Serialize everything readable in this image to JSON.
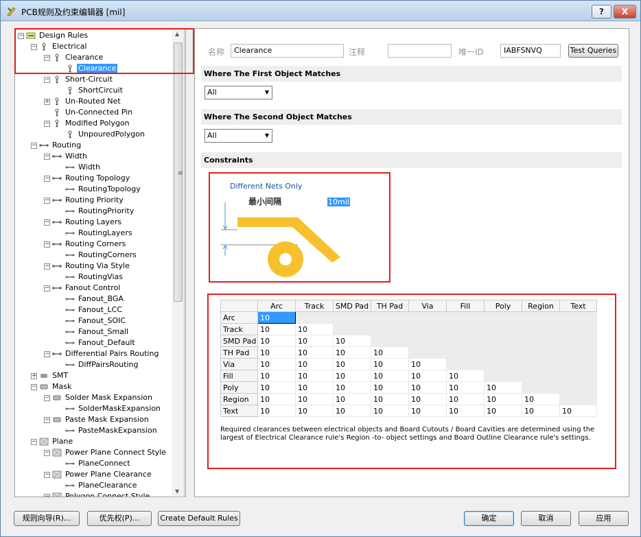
{
  "window": {
    "title": "PCB规则及约束编辑器 [mil]",
    "help_label": "?",
    "close_label": "X"
  },
  "tree": {
    "rows": [
      {
        "label": "Design Rules",
        "exp": "−"
      },
      {
        "label": "Electrical",
        "exp": "−"
      },
      {
        "label": "Clearance",
        "exp": "−"
      },
      {
        "label": "Clearance",
        "exp": ""
      },
      {
        "label": "Short-Circuit",
        "exp": "−"
      },
      {
        "label": "ShortCircuit",
        "exp": ""
      },
      {
        "label": "Un-Routed Net",
        "exp": "+"
      },
      {
        "label": "Un-Connected Pin",
        "exp": ""
      },
      {
        "label": "Modified Polygon",
        "exp": "−"
      },
      {
        "label": "UnpouredPolygon",
        "exp": ""
      },
      {
        "label": "Routing",
        "exp": "−"
      },
      {
        "label": "Width",
        "exp": "−"
      },
      {
        "label": "Width",
        "exp": ""
      },
      {
        "label": "Routing Topology",
        "exp": "−"
      },
      {
        "label": "RoutingTopology",
        "exp": ""
      },
      {
        "label": "Routing Priority",
        "exp": "−"
      },
      {
        "label": "RoutingPriority",
        "exp": ""
      },
      {
        "label": "Routing Layers",
        "exp": "−"
      },
      {
        "label": "RoutingLayers",
        "exp": ""
      },
      {
        "label": "Routing Corners",
        "exp": "−"
      },
      {
        "label": "RoutingCorners",
        "exp": ""
      },
      {
        "label": "Routing Via Style",
        "exp": "−"
      },
      {
        "label": "RoutingVias",
        "exp": ""
      },
      {
        "label": "Fanout Control",
        "exp": "−"
      },
      {
        "label": "Fanout_BGA",
        "exp": ""
      },
      {
        "label": "Fanout_LCC",
        "exp": ""
      },
      {
        "label": "Fanout_SOIC",
        "exp": ""
      },
      {
        "label": "Fanout_Small",
        "exp": ""
      },
      {
        "label": "Fanout_Default",
        "exp": ""
      },
      {
        "label": "Differential Pairs Routing",
        "exp": "−"
      },
      {
        "label": "DiffPairsRouting",
        "exp": ""
      },
      {
        "label": "SMT",
        "exp": "+"
      },
      {
        "label": "Mask",
        "exp": "−"
      },
      {
        "label": "Solder Mask Expansion",
        "exp": "−"
      },
      {
        "label": "SolderMaskExpansion",
        "exp": ""
      },
      {
        "label": "Paste Mask Expansion",
        "exp": "−"
      },
      {
        "label": "PasteMaskExpansion",
        "exp": ""
      },
      {
        "label": "Plane",
        "exp": "−"
      },
      {
        "label": "Power Plane Connect Style",
        "exp": "−"
      },
      {
        "label": "PlaneConnect",
        "exp": ""
      },
      {
        "label": "Power Plane Clearance",
        "exp": "−"
      },
      {
        "label": "PlaneClearance",
        "exp": ""
      },
      {
        "label": "Polygon Connect Style",
        "exp": "−"
      }
    ]
  },
  "rule": {
    "name_label": "名称",
    "name_value": "Clearance",
    "comment_label": "注释",
    "comment_value": "",
    "uid_label": "唯一ID",
    "uid_value": "IABFSNVQ",
    "test_queries_label": "Test Queries"
  },
  "first_match": {
    "header": "Where The First Object Matches",
    "value": "All"
  },
  "second_match": {
    "header": "Where The Second Object Matches",
    "value": "All"
  },
  "constraints": {
    "header": "Constraints",
    "net_scope": "Different Nets Only",
    "min_clearance_label": "最小间隔",
    "min_clearance_value": "10mil"
  },
  "matrix": {
    "columns": [
      "Arc",
      "Track",
      "SMD Pad",
      "TH Pad",
      "Via",
      "Fill",
      "Poly",
      "Region",
      "Text"
    ],
    "rows": [
      {
        "label": "Arc",
        "values": [
          "10"
        ]
      },
      {
        "label": "Track",
        "values": [
          "10",
          "10"
        ]
      },
      {
        "label": "SMD Pad",
        "values": [
          "10",
          "10",
          "10"
        ]
      },
      {
        "label": "TH Pad",
        "values": [
          "10",
          "10",
          "10",
          "10"
        ]
      },
      {
        "label": "Via",
        "values": [
          "10",
          "10",
          "10",
          "10",
          "10"
        ]
      },
      {
        "label": "Fill",
        "values": [
          "10",
          "10",
          "10",
          "10",
          "10",
          "10"
        ]
      },
      {
        "label": "Poly",
        "values": [
          "10",
          "10",
          "10",
          "10",
          "10",
          "10",
          "10"
        ]
      },
      {
        "label": "Region",
        "values": [
          "10",
          "10",
          "10",
          "10",
          "10",
          "10",
          "10",
          "10"
        ]
      },
      {
        "label": "Text",
        "values": [
          "10",
          "10",
          "10",
          "10",
          "10",
          "10",
          "10",
          "10",
          "10"
        ]
      }
    ],
    "note": "Required clearances between electrical objects and Board Cutouts / Board Cavities are determined using the largest of Electrical Clearance rule's Region -to- object settings and Board Outline Clearance rule's settings."
  },
  "footer": {
    "rule_wizard_label": "规则向导(R)...",
    "priority_label": "优先权(P)...",
    "create_default_label": "Create Default Rules",
    "ok_label": "确定",
    "cancel_label": "取消",
    "apply_label": "应用"
  },
  "colors": {
    "selection": "#3399ff",
    "annotation_box": "#e02020",
    "pad_fill": "#f7c12e",
    "link_text": "#1a55a0"
  }
}
